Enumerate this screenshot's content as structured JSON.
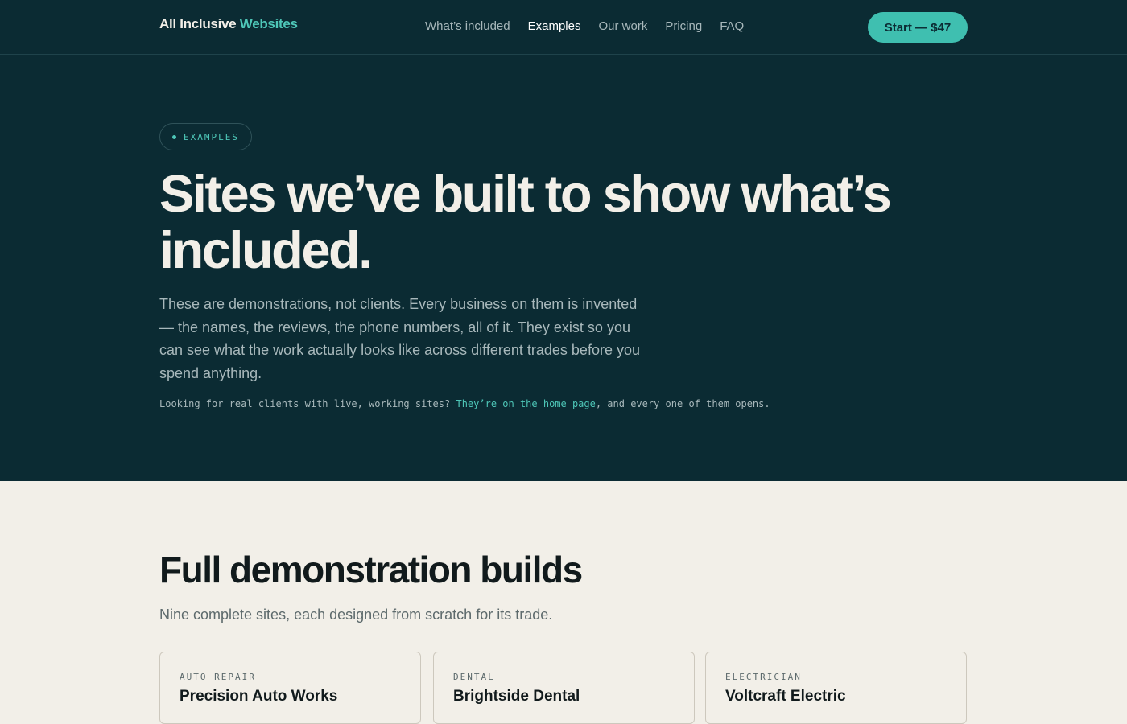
{
  "nav": {
    "brand_main": "All Inclusive",
    "brand_accent": "Websites",
    "links": [
      "What’s included",
      "Examples",
      "Our work",
      "Pricing",
      "FAQ"
    ],
    "active_link": "Examples",
    "cta_label": "Start — $47"
  },
  "hero": {
    "pill_label": "EXAMPLES",
    "title": "Sites we’ve built to show what’s included.",
    "lede": "These are demonstrations, not clients. Every business on them is invented — the names, the reviews, the phone numbers, all of it. They exist so you can see what the work actually looks like across different trades before you spend anything.",
    "note_before": "Looking for real clients with live, working sites? ",
    "note_link": "They’re on the home page",
    "note_after": ", and every one of them opens."
  },
  "builds": {
    "title": "Full demonstration builds",
    "subtitle": "Nine complete sites, each designed from scratch for its trade.",
    "cards": [
      {
        "category": "AUTO REPAIR",
        "name": "Precision Auto Works"
      },
      {
        "category": "DENTAL",
        "name": "Brightside Dental"
      },
      {
        "category": "ELECTRICIAN",
        "name": "Voltcraft Electric"
      }
    ]
  },
  "colors": {
    "navy": "#0b2b33",
    "teal": "#3fbfb0",
    "cream": "#f2efe8"
  }
}
